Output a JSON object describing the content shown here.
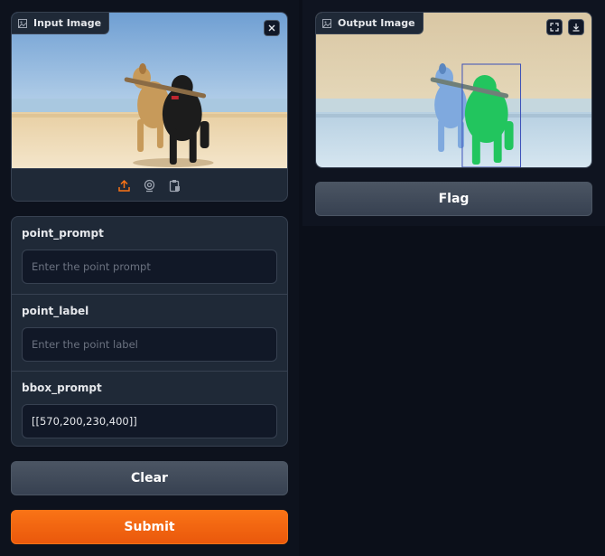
{
  "input_image": {
    "label": "Input Image",
    "close_icon": "close-icon",
    "toolbar_icons": [
      "upload-icon",
      "webcam-icon",
      "clipboard-icon"
    ],
    "accent_color": "#f97316"
  },
  "output_image": {
    "label": "Output Image",
    "toolbar_icons": [
      "fullscreen-icon",
      "download-icon"
    ],
    "mask_colors": [
      "#3b82f6",
      "#22c55e"
    ]
  },
  "form": {
    "point_prompt": {
      "label": "point_prompt",
      "placeholder": "Enter the point prompt",
      "value": ""
    },
    "point_label": {
      "label": "point_label",
      "placeholder": "Enter the point label",
      "value": ""
    },
    "bbox_prompt": {
      "label": "bbox_prompt",
      "placeholder": "",
      "value": "[[570,200,230,400]]"
    }
  },
  "buttons": {
    "flag": "Flag",
    "clear": "Clear",
    "submit": "Submit"
  }
}
